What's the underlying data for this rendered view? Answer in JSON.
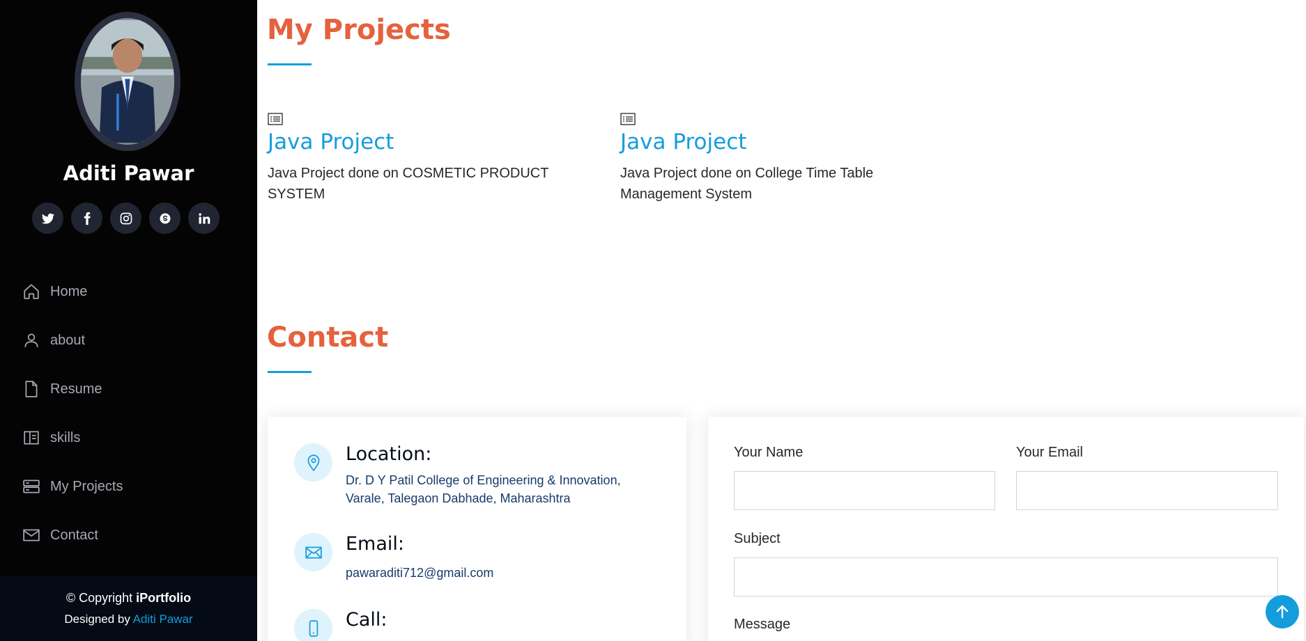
{
  "profile": {
    "name": "Aditi Pawar",
    "avatar_alt": "profile photo"
  },
  "social": [
    {
      "icon": "twitter-icon"
    },
    {
      "icon": "facebook-icon"
    },
    {
      "icon": "instagram-icon"
    },
    {
      "icon": "skype-icon"
    },
    {
      "icon": "linkedin-icon"
    }
  ],
  "nav": {
    "items": [
      {
        "label": "Home",
        "icon": "home-icon"
      },
      {
        "label": "about",
        "icon": "person-icon"
      },
      {
        "label": "Resume",
        "icon": "file-icon"
      },
      {
        "label": "skills",
        "icon": "book-icon"
      },
      {
        "label": "My Projects",
        "icon": "server-icon"
      },
      {
        "label": "Contact",
        "icon": "envelope-icon"
      }
    ]
  },
  "footer": {
    "copyright_prefix": "© Copyright ",
    "copyright_brand": "iPortfolio",
    "designed_by": "Designed by ",
    "designer": "Aditi Pawar"
  },
  "projects": {
    "title": "My Projects",
    "items": [
      {
        "title": "Java Project",
        "description": "Java Project done on COSMETIC PRODUCT SYSTEM",
        "icon": "list-icon"
      },
      {
        "title": "Java Project",
        "description": "Java Project done on College Time Table Management System",
        "icon": "list-icon"
      }
    ]
  },
  "contact": {
    "title": "Contact",
    "location": {
      "label": "Location:",
      "value": "Dr. D Y Patil College of Engineering & Innovation, Varale, Talegaon Dabhade, Maharashtra"
    },
    "email": {
      "label": "Email:",
      "value": "pawaraditi712@gmail.com"
    },
    "call": {
      "label": "Call:"
    },
    "form": {
      "name_label": "Your Name",
      "email_label": "Your Email",
      "subject_label": "Subject",
      "message_label": "Message",
      "name_value": "",
      "email_value": "",
      "subject_value": ""
    }
  },
  "colors": {
    "accent": "#149ddd",
    "heading": "#e4623d",
    "sidebar_bg": "#040404"
  }
}
